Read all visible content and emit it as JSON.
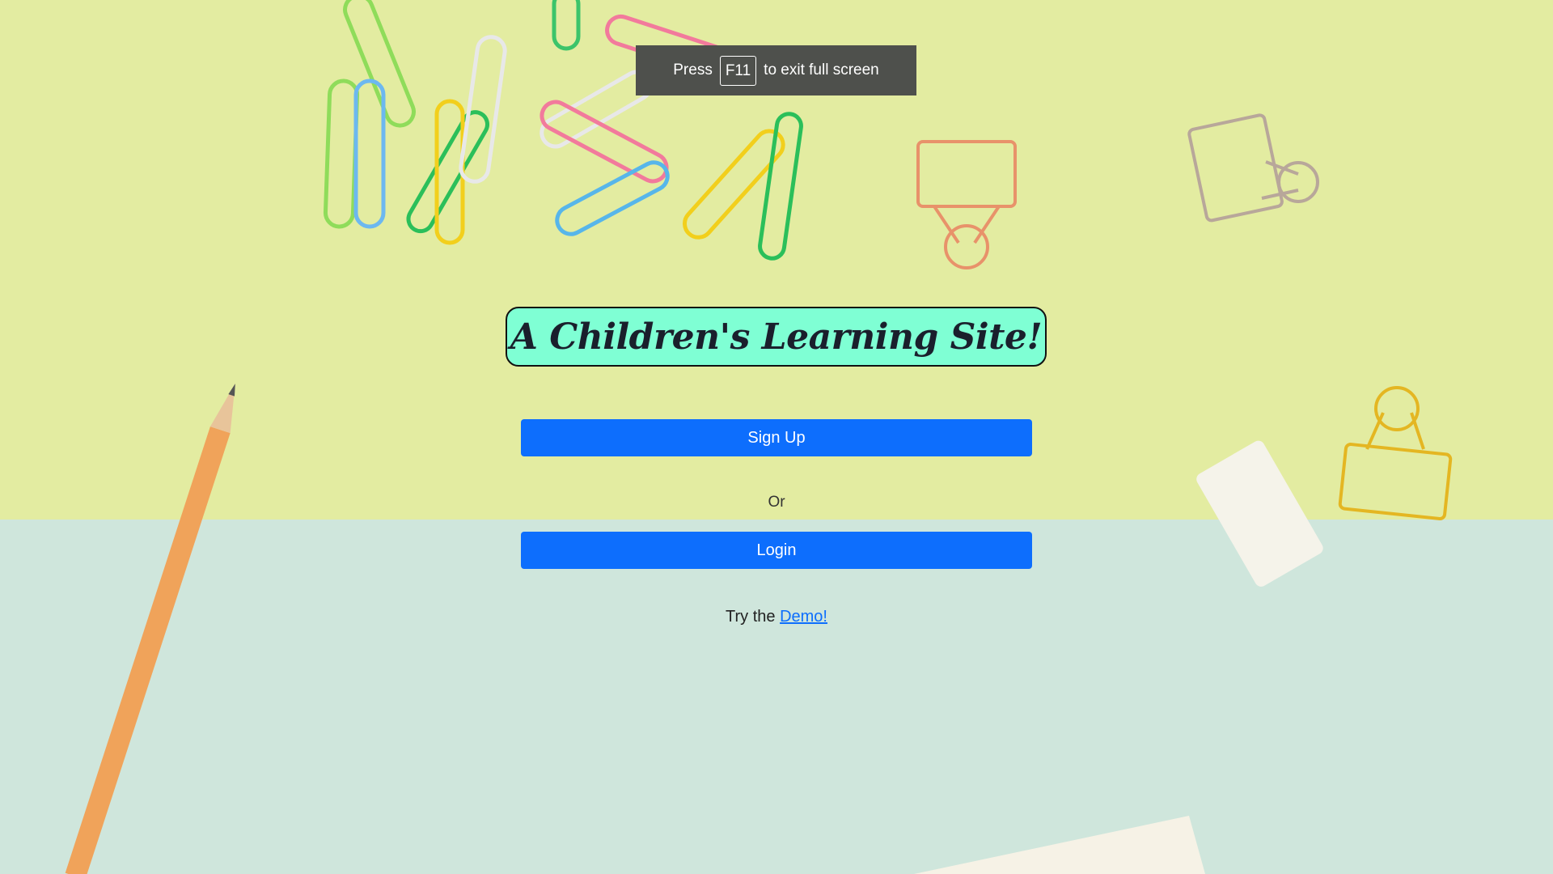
{
  "fullscreen_notice": {
    "prefix": "Press",
    "key": "F11",
    "suffix": "to exit full screen"
  },
  "title": "A Children's Learning Site!",
  "signup_label": "Sign Up",
  "or_label": "Or",
  "login_label": "Login",
  "demo": {
    "prefix": "Try the",
    "link_label": "Demo!"
  },
  "colors": {
    "primary_button": "#0d6efd",
    "title_background": "#7fffd4",
    "background_top": "#e3eca1",
    "background_bottom": "#cfe6dc"
  }
}
